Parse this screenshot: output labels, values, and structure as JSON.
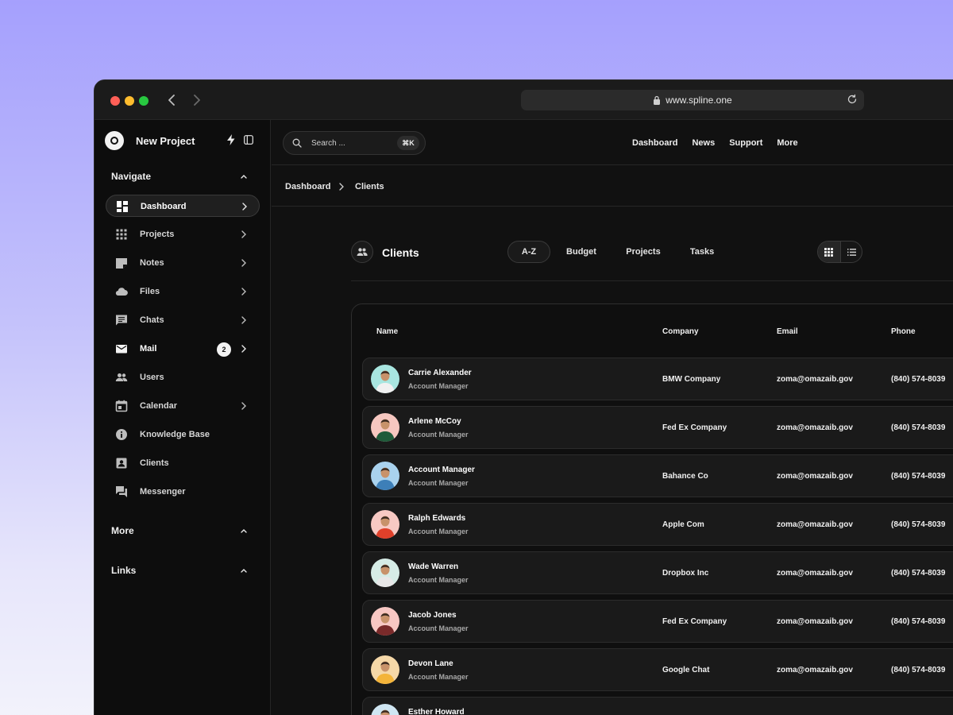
{
  "browser": {
    "url": "www.spline.one"
  },
  "sidebar": {
    "project_title": "New Project",
    "navigate_label": "Navigate",
    "items": [
      {
        "label": "Dashboard",
        "icon": "dashboard-icon",
        "active": true,
        "chevron": true
      },
      {
        "label": "Projects",
        "icon": "grid-icon",
        "chevron": true
      },
      {
        "label": "Notes",
        "icon": "note-icon",
        "chevron": true
      },
      {
        "label": "Files",
        "icon": "cloud-icon",
        "chevron": true
      },
      {
        "label": "Chats",
        "icon": "chat-icon",
        "chevron": true
      },
      {
        "label": "Mail",
        "icon": "mail-icon",
        "badge": "2",
        "chevron": true
      },
      {
        "label": "Users",
        "icon": "users-icon",
        "chevron": false
      },
      {
        "label": "Calendar",
        "icon": "calendar-icon",
        "chevron": true
      },
      {
        "label": "Knowledge Base",
        "icon": "info-icon",
        "chevron": false
      },
      {
        "label": "Clients",
        "icon": "contact-icon",
        "chevron": false
      },
      {
        "label": "Messenger",
        "icon": "messenger-icon",
        "chevron": false
      }
    ],
    "more_label": "More",
    "links_label": "Links"
  },
  "topbar": {
    "search_placeholder": "Search ...",
    "search_shortcut": "⌘K",
    "links": [
      "Dashboard",
      "News",
      "Support",
      "More"
    ]
  },
  "breadcrumb": {
    "parent": "Dashboard",
    "current": "Clients"
  },
  "clients": {
    "title": "Clients",
    "tabs": [
      "A-Z",
      "Budget",
      "Projects",
      "Tasks"
    ],
    "active_tab": "A-Z",
    "view_mode": "grid"
  },
  "table": {
    "headers": {
      "name": "Name",
      "company": "Company",
      "email": "Email",
      "phone": "Phone"
    },
    "rows": [
      {
        "name": "Carrie Alexander",
        "role": "Account Manager",
        "company": "BMW Company",
        "email": "zoma@omazaib.gov",
        "phone": "(840) 574-8039",
        "avatar_bg": "#a8e6e0",
        "shirt": "#f1f1f1"
      },
      {
        "name": "Arlene McCoy",
        "role": "Account Manager",
        "company": "Fed Ex Company",
        "email": "zoma@omazaib.gov",
        "phone": "(840) 574-8039",
        "avatar_bg": "#f6c7c0",
        "shirt": "#1f5a3a"
      },
      {
        "name": "Account Manager",
        "role": "Account Manager",
        "company": "Bahance Co",
        "email": "zoma@omazaib.gov",
        "phone": "(840) 574-8039",
        "avatar_bg": "#a9d2ee",
        "shirt": "#3d7fb8"
      },
      {
        "name": "Ralph Edwards",
        "role": "Account Manager",
        "company": "Apple Com",
        "email": "zoma@omazaib.gov",
        "phone": "(840) 574-8039",
        "avatar_bg": "#f7c9c3",
        "shirt": "#e0402a"
      },
      {
        "name": "Wade Warren",
        "role": "Account Manager",
        "company": "Dropbox Inc",
        "email": "zoma@omazaib.gov",
        "phone": "(840) 574-8039",
        "avatar_bg": "#d6ece6",
        "shirt": "#e8e8e8"
      },
      {
        "name": "Jacob Jones",
        "role": "Account Manager",
        "company": "Fed Ex Company",
        "email": "zoma@omazaib.gov",
        "phone": "(840) 574-8039",
        "avatar_bg": "#f7c7c3",
        "shirt": "#7a2a2a"
      },
      {
        "name": "Devon Lane",
        "role": "Account Manager",
        "company": "Google Chat",
        "email": "zoma@omazaib.gov",
        "phone": "(840) 574-8039",
        "avatar_bg": "#f5d8a8",
        "shirt": "#f3b43a"
      },
      {
        "name": "Esther Howard",
        "role": "",
        "company": "",
        "email": "",
        "phone": "",
        "avatar_bg": "#cfe6f2",
        "shirt": "#3b3b3b"
      }
    ]
  }
}
